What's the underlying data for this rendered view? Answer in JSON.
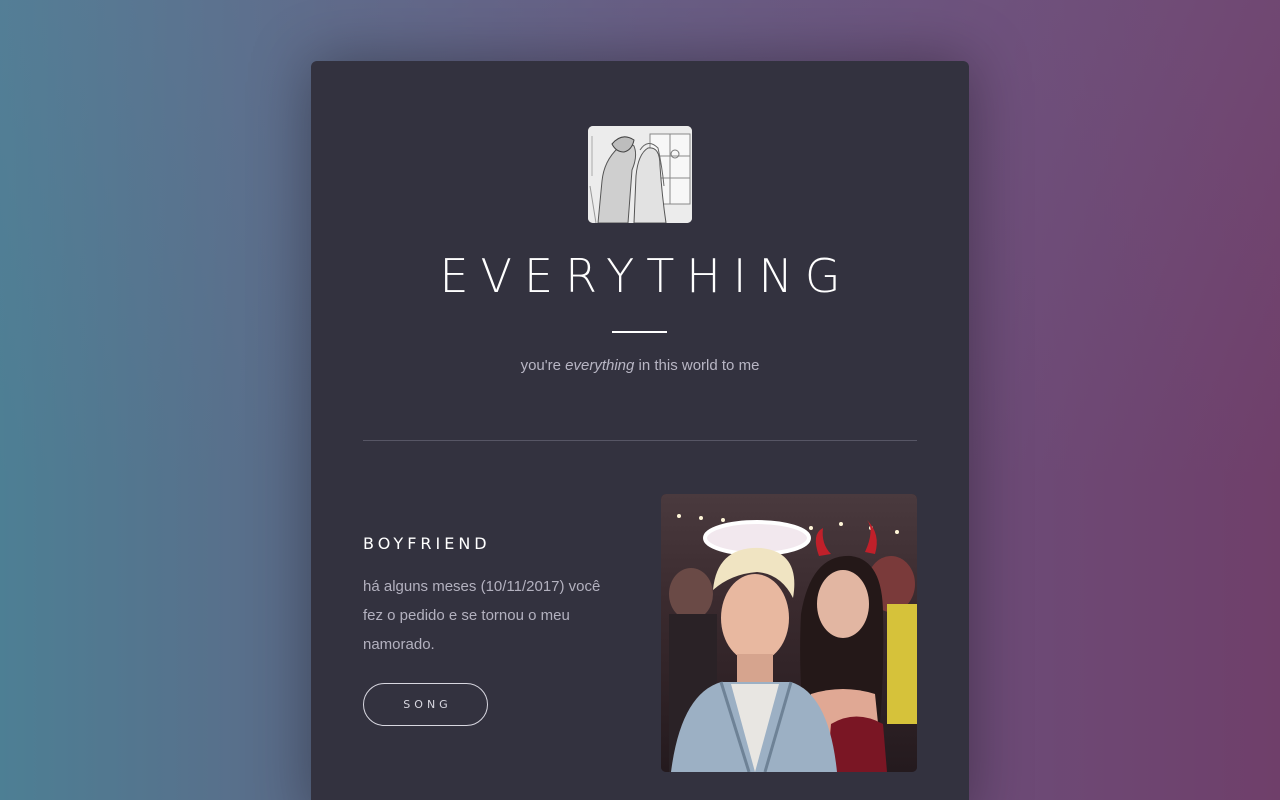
{
  "site": {
    "title": "EVERYTHING",
    "tagline_prefix": "you're ",
    "tagline_emphasis": "everything",
    "tagline_suffix": " in this world to me"
  },
  "post": {
    "heading": "BOYFRIEND",
    "body": "há alguns meses (10/11/2017) você fez o pedido e se tornou o meu namorado.",
    "button_label": "SONG"
  },
  "images": {
    "avatar": "manga-couple-illustration",
    "photo": "couple-costume-photo"
  },
  "colors": {
    "card": "#33323f",
    "text_primary": "#ffffff",
    "text_muted": "#b3b1bf"
  }
}
